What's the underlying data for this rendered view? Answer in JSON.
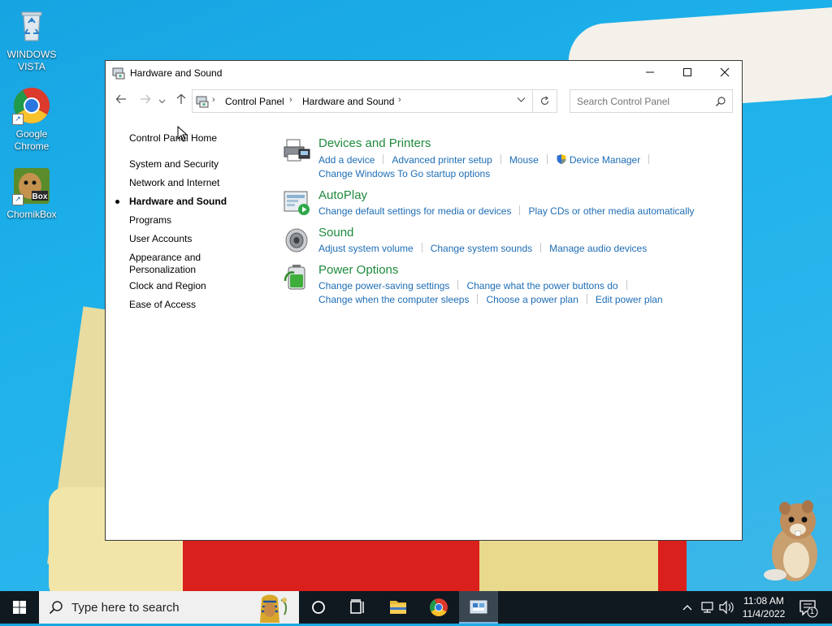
{
  "desktop": {
    "icons": [
      {
        "label_line1": "WINDOWS",
        "label_line2": "VISTA",
        "icon": "recycle-bin-icon"
      },
      {
        "label_line1": "Google",
        "label_line2": "Chrome",
        "icon": "chrome-icon"
      },
      {
        "label_line1": "ChomikBox",
        "label_line2": "",
        "icon": "chomikbox-icon"
      }
    ]
  },
  "window": {
    "title": "Hardware and Sound",
    "controls": {
      "minimize": "—",
      "maximize": "☐",
      "close": "✕"
    },
    "breadcrumb": [
      "Control Panel",
      "Hardware and Sound"
    ],
    "search_placeholder": "Search Control Panel"
  },
  "leftnav": {
    "home": "Control Panel Home",
    "items": [
      {
        "label": "System and Security",
        "active": false
      },
      {
        "label": "Network and Internet",
        "active": false
      },
      {
        "label": "Hardware and Sound",
        "active": true
      },
      {
        "label": "Programs",
        "active": false
      },
      {
        "label": "User Accounts",
        "active": false
      },
      {
        "label": "Appearance and",
        "label2": "Personalization",
        "active": false
      },
      {
        "label": "Clock and Region",
        "active": false
      },
      {
        "label": "Ease of Access",
        "active": false
      }
    ]
  },
  "categories": [
    {
      "title": "Devices and Printers",
      "icon": "printer-icon",
      "links_row1": [
        "Add a device",
        "Advanced printer setup",
        "Mouse",
        "Device Manager"
      ],
      "links_row2": [
        "Change Windows To Go startup options"
      ]
    },
    {
      "title": "AutoPlay",
      "icon": "autoplay-icon",
      "links_row1": [
        "Change default settings for media or devices",
        "Play CDs or other media automatically"
      ]
    },
    {
      "title": "Sound",
      "icon": "speaker-icon",
      "links_row1": [
        "Adjust system volume",
        "Change system sounds",
        "Manage audio devices"
      ]
    },
    {
      "title": "Power Options",
      "icon": "battery-icon",
      "links_row1": [
        "Change power-saving settings",
        "Change what the power buttons do"
      ],
      "links_row2": [
        "Change when the computer sleeps",
        "Choose a power plan",
        "Edit power plan"
      ]
    }
  ],
  "taskbar": {
    "search_placeholder": "Type here to search",
    "time": "11:08 AM",
    "date": "11/4/2022",
    "notification_count": "1"
  },
  "colors": {
    "category_title": "#1f8a3c",
    "link": "#1e6db5",
    "desktop": "#1db1ea",
    "taskbar": "#101820"
  }
}
